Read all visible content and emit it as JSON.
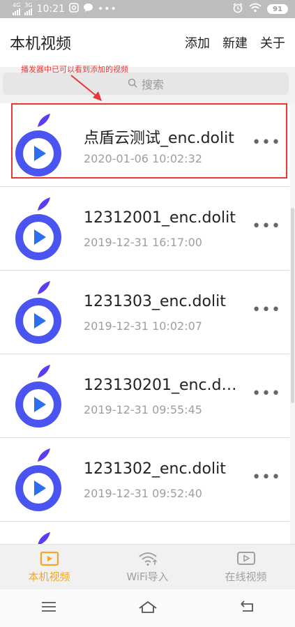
{
  "status_bar": {
    "network_top": "4G",
    "network_second": "3G",
    "time": "10:21",
    "battery": "91"
  },
  "header": {
    "title": "本机视频",
    "actions": {
      "add": "添加",
      "new": "新建",
      "about": "关于"
    }
  },
  "annotation": {
    "text": "播发器中已可以看到添加的视频",
    "color": "#e53935"
  },
  "search": {
    "placeholder": "搜索"
  },
  "videos": [
    {
      "title": "点盾云测试_enc.dolit",
      "date": "2020-01-06 10:02:32"
    },
    {
      "title": "12312001_enc.dolit",
      "date": "2019-12-31 16:17:00"
    },
    {
      "title": "1231303_enc.dolit",
      "date": "2019-12-31 10:02:07"
    },
    {
      "title": "123130201_enc.d…",
      "date": "2019-12-31 09:55:45"
    },
    {
      "title": "1231302_enc.dolit",
      "date": "2019-12-31 09:52:40"
    }
  ],
  "tabs": [
    {
      "label": "本机视频",
      "icon": "local-video-icon",
      "active": true
    },
    {
      "label": "WiFi导入",
      "icon": "wifi-import-icon",
      "active": false
    },
    {
      "label": "在线视频",
      "icon": "online-video-icon",
      "active": false
    }
  ],
  "colors": {
    "accent": "#f5a623",
    "brand_purple": "#5b3cf0",
    "brand_blue": "#2a6ff0",
    "highlight": "#e53935"
  }
}
